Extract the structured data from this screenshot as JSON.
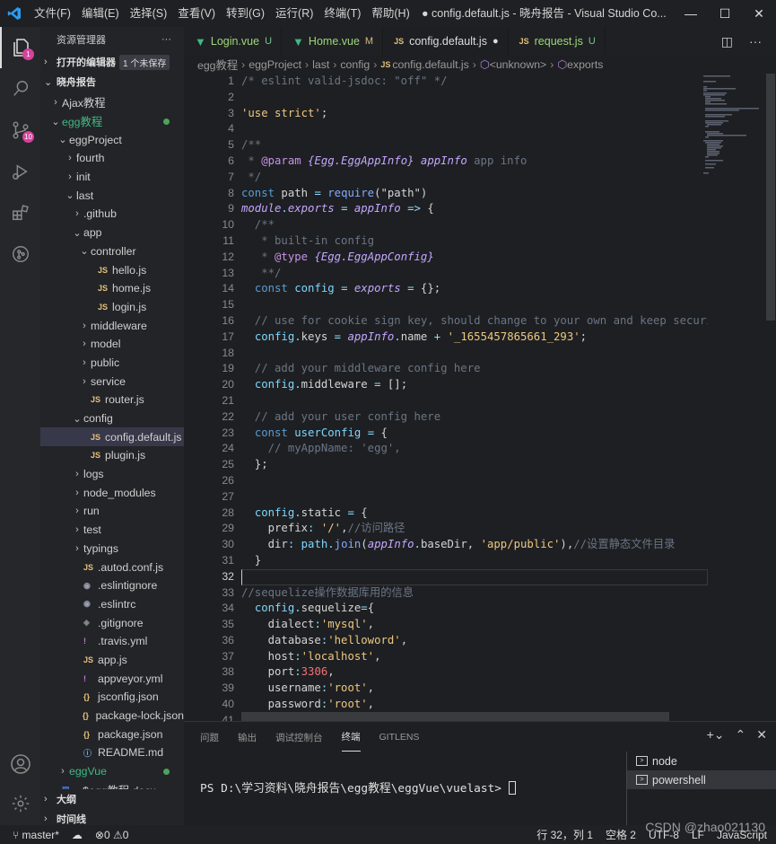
{
  "window": {
    "menu": [
      "文件(F)",
      "编辑(E)",
      "选择(S)",
      "查看(V)",
      "转到(G)",
      "运行(R)",
      "终端(T)",
      "帮助(H)"
    ],
    "title": "● config.default.js - 晓舟报告 - Visual Studio Co..."
  },
  "activity": {
    "explorer_badge": "1",
    "scm_badge": "10"
  },
  "sidebar": {
    "header": "资源管理器",
    "open_editors": "打开的编辑器",
    "unsaved": "1 个未保存",
    "workspace": "晓舟报告",
    "outline": "大纲",
    "timeline": "时间线",
    "items": [
      {
        "label": "Ajax教程",
        "depth": 1,
        "chev": "›",
        "icon": ""
      },
      {
        "label": "egg教程",
        "depth": 1,
        "chev": "⌄",
        "icon": "",
        "color": "#41b883",
        "dot": true
      },
      {
        "label": "eggProject",
        "depth": 2,
        "chev": "⌄",
        "icon": ""
      },
      {
        "label": "fourth",
        "depth": 3,
        "chev": "›",
        "icon": ""
      },
      {
        "label": "init",
        "depth": 3,
        "chev": "›",
        "icon": ""
      },
      {
        "label": "last",
        "depth": 3,
        "chev": "⌄",
        "icon": ""
      },
      {
        "label": ".github",
        "depth": 4,
        "chev": "›",
        "icon": ""
      },
      {
        "label": "app",
        "depth": 4,
        "chev": "⌄",
        "icon": ""
      },
      {
        "label": "controller",
        "depth": 5,
        "chev": "⌄",
        "icon": ""
      },
      {
        "label": "hello.js",
        "depth": 6,
        "chev": "",
        "icon": "JS"
      },
      {
        "label": "home.js",
        "depth": 6,
        "chev": "",
        "icon": "JS"
      },
      {
        "label": "login.js",
        "depth": 6,
        "chev": "",
        "icon": "JS"
      },
      {
        "label": "middleware",
        "depth": 5,
        "chev": "›",
        "icon": ""
      },
      {
        "label": "model",
        "depth": 5,
        "chev": "›",
        "icon": ""
      },
      {
        "label": "public",
        "depth": 5,
        "chev": "›",
        "icon": ""
      },
      {
        "label": "service",
        "depth": 5,
        "chev": "›",
        "icon": ""
      },
      {
        "label": "router.js",
        "depth": 5,
        "chev": "",
        "icon": "JS"
      },
      {
        "label": "config",
        "depth": 4,
        "chev": "⌄",
        "icon": ""
      },
      {
        "label": "config.default.js",
        "depth": 5,
        "chev": "",
        "icon": "JS",
        "selected": true
      },
      {
        "label": "plugin.js",
        "depth": 5,
        "chev": "",
        "icon": "JS"
      },
      {
        "label": "logs",
        "depth": 4,
        "chev": "›",
        "icon": ""
      },
      {
        "label": "node_modules",
        "depth": 4,
        "chev": "›",
        "icon": ""
      },
      {
        "label": "run",
        "depth": 4,
        "chev": "›",
        "icon": ""
      },
      {
        "label": "test",
        "depth": 4,
        "chev": "›",
        "icon": ""
      },
      {
        "label": "typings",
        "depth": 4,
        "chev": "›",
        "icon": ""
      },
      {
        "label": ".autod.conf.js",
        "depth": 4,
        "chev": "",
        "icon": "JS"
      },
      {
        "label": ".eslintignore",
        "depth": 4,
        "chev": "",
        "icon": "◉"
      },
      {
        "label": ".eslintrc",
        "depth": 4,
        "chev": "",
        "icon": "◉"
      },
      {
        "label": ".gitignore",
        "depth": 4,
        "chev": "",
        "icon": "◈"
      },
      {
        "label": ".travis.yml",
        "depth": 4,
        "chev": "",
        "icon": "!"
      },
      {
        "label": "app.js",
        "depth": 4,
        "chev": "",
        "icon": "JS"
      },
      {
        "label": "appveyor.yml",
        "depth": 4,
        "chev": "",
        "icon": "!"
      },
      {
        "label": "jsconfig.json",
        "depth": 4,
        "chev": "",
        "icon": "{}"
      },
      {
        "label": "package-lock.json",
        "depth": 4,
        "chev": "",
        "icon": "{}"
      },
      {
        "label": "package.json",
        "depth": 4,
        "chev": "",
        "icon": "{}"
      },
      {
        "label": "README.md",
        "depth": 4,
        "chev": "",
        "icon": "ⓘ"
      },
      {
        "label": "eggVue",
        "depth": 2,
        "chev": "›",
        "icon": "",
        "color": "#41b883",
        "dot": true
      },
      {
        "label": "~$egg教程.docx",
        "depth": 1,
        "chev": "",
        "icon": "▤"
      }
    ]
  },
  "tabs": [
    {
      "label": "Login.vue",
      "status": "U",
      "type": "vue",
      "active": false
    },
    {
      "label": "Home.vue",
      "status": "M",
      "type": "vue",
      "active": false
    },
    {
      "label": "config.default.js",
      "status": "●",
      "type": "js",
      "active": true
    },
    {
      "label": "request.js",
      "status": "U",
      "type": "js",
      "active": false
    }
  ],
  "breadcrumbs": [
    "egg教程",
    "eggProject",
    "last",
    "config",
    "config.default.js",
    "<unknown>",
    "exports"
  ],
  "editor": {
    "current_line": 32,
    "lines": [
      [
        [
          "c",
          "/* eslint valid-jsdoc: \"off\" */"
        ]
      ],
      [],
      [
        [
          "s",
          "'use strict'"
        ],
        [
          "t",
          ";"
        ]
      ],
      [],
      [
        [
          "c",
          "/**"
        ]
      ],
      [
        [
          "c",
          " * "
        ],
        [
          "tg",
          "@param"
        ],
        [
          "c",
          " "
        ],
        [
          "i",
          "{Egg.EggAppInfo}"
        ],
        [
          "c",
          " "
        ],
        [
          "i",
          "appInfo"
        ],
        [
          "c",
          " app info"
        ]
      ],
      [
        [
          "c",
          " */"
        ]
      ],
      [
        [
          "k",
          "const"
        ],
        [
          "t",
          " path "
        ],
        [
          "v",
          "="
        ],
        [
          "t",
          " "
        ],
        [
          "f",
          "require"
        ],
        [
          "t",
          "(\"path\")"
        ]
      ],
      [
        [
          "i",
          "module"
        ],
        [
          "v",
          "."
        ],
        [
          "i",
          "exports"
        ],
        [
          "t",
          " "
        ],
        [
          "v",
          "="
        ],
        [
          "t",
          " "
        ],
        [
          "i",
          "appInfo"
        ],
        [
          "t",
          " "
        ],
        [
          "v",
          "=>"
        ],
        [
          "t",
          " {"
        ]
      ],
      [
        [
          "c",
          "  /**"
        ]
      ],
      [
        [
          "c",
          "   * built-in config"
        ]
      ],
      [
        [
          "c",
          "   * "
        ],
        [
          "tg",
          "@type"
        ],
        [
          "c",
          " "
        ],
        [
          "i",
          "{Egg.EggAppConfig}"
        ]
      ],
      [
        [
          "c",
          "   **/"
        ]
      ],
      [
        [
          "t",
          "  "
        ],
        [
          "k",
          "const"
        ],
        [
          "t",
          " "
        ],
        [
          "pr",
          "config"
        ],
        [
          "t",
          " "
        ],
        [
          "v",
          "="
        ],
        [
          "t",
          " "
        ],
        [
          "i",
          "exports"
        ],
        [
          "t",
          " "
        ],
        [
          "v",
          "="
        ],
        [
          "t",
          " {};"
        ]
      ],
      [],
      [
        [
          "c",
          "  // use for cookie sign key, should change to your own and keep security"
        ]
      ],
      [
        [
          "t",
          "  "
        ],
        [
          "pr",
          "config"
        ],
        [
          "v",
          "."
        ],
        [
          "t",
          "keys "
        ],
        [
          "v",
          "="
        ],
        [
          "t",
          " "
        ],
        [
          "i",
          "appInfo"
        ],
        [
          "v",
          "."
        ],
        [
          "t",
          "name "
        ],
        [
          "v",
          "+"
        ],
        [
          "t",
          " "
        ],
        [
          "s",
          "'_1655457865661_293'"
        ],
        [
          "t",
          ";"
        ]
      ],
      [],
      [
        [
          "c",
          "  // add your middleware config here"
        ]
      ],
      [
        [
          "t",
          "  "
        ],
        [
          "pr",
          "config"
        ],
        [
          "v",
          "."
        ],
        [
          "t",
          "middleware "
        ],
        [
          "v",
          "="
        ],
        [
          "t",
          " [];"
        ]
      ],
      [],
      [
        [
          "c",
          "  // add your user config here"
        ]
      ],
      [
        [
          "t",
          "  "
        ],
        [
          "k",
          "const"
        ],
        [
          "t",
          " "
        ],
        [
          "pr",
          "userConfig"
        ],
        [
          "t",
          " "
        ],
        [
          "v",
          "="
        ],
        [
          "t",
          " {"
        ]
      ],
      [
        [
          "c",
          "    // myAppName: 'egg',"
        ]
      ],
      [
        [
          "t",
          "  };"
        ]
      ],
      [],
      [],
      [
        [
          "t",
          "  "
        ],
        [
          "pr",
          "config"
        ],
        [
          "v",
          "."
        ],
        [
          "t",
          "static "
        ],
        [
          "v",
          "="
        ],
        [
          "t",
          " {"
        ]
      ],
      [
        [
          "t",
          "    prefix"
        ],
        [
          "v",
          ":"
        ],
        [
          "t",
          " "
        ],
        [
          "s",
          "'/'"
        ],
        [
          "t",
          ","
        ],
        [
          "c",
          "//访问路径"
        ]
      ],
      [
        [
          "t",
          "    dir"
        ],
        [
          "v",
          ":"
        ],
        [
          "t",
          " "
        ],
        [
          "pr",
          "path"
        ],
        [
          "v",
          "."
        ],
        [
          "f",
          "join"
        ],
        [
          "t",
          "("
        ],
        [
          "i",
          "appInfo"
        ],
        [
          "v",
          "."
        ],
        [
          "t",
          "baseDir, "
        ],
        [
          "s",
          "'app/public'"
        ],
        [
          "t",
          "),"
        ],
        [
          "c",
          "//设置静态文件目录"
        ]
      ],
      [
        [
          "t",
          "  }"
        ]
      ],
      [],
      [
        [
          "c",
          "//sequelize操作数据库用的信息"
        ]
      ],
      [
        [
          "t",
          "  "
        ],
        [
          "pr",
          "config"
        ],
        [
          "v",
          "."
        ],
        [
          "t",
          "sequelize"
        ],
        [
          "v",
          "="
        ],
        [
          "t",
          "{"
        ]
      ],
      [
        [
          "t",
          "    dialect"
        ],
        [
          "v",
          ":"
        ],
        [
          "s",
          "'mysql'"
        ],
        [
          "t",
          ","
        ]
      ],
      [
        [
          "t",
          "    database"
        ],
        [
          "v",
          ":"
        ],
        [
          "s",
          "'helloword'"
        ],
        [
          "t",
          ","
        ]
      ],
      [
        [
          "t",
          "    host"
        ],
        [
          "v",
          ":"
        ],
        [
          "s",
          "'localhost'"
        ],
        [
          "t",
          ","
        ]
      ],
      [
        [
          "t",
          "    port"
        ],
        [
          "v",
          ":"
        ],
        [
          "p",
          "3306"
        ],
        [
          "t",
          ","
        ]
      ],
      [
        [
          "t",
          "    username"
        ],
        [
          "v",
          ":"
        ],
        [
          "s",
          "'root'"
        ],
        [
          "t",
          ","
        ]
      ],
      [
        [
          "t",
          "    password"
        ],
        [
          "v",
          ":"
        ],
        [
          "s",
          "'root'"
        ],
        [
          "t",
          ","
        ]
      ],
      [
        [
          "t",
          "  },"
        ]
      ]
    ]
  },
  "panel": {
    "tabs": [
      "问题",
      "输出",
      "调试控制台",
      "终端",
      "GITLENS"
    ],
    "active_tab": "终端",
    "terminal_prompt": "PS D:\\学习资料\\晓舟报告\\egg教程\\eggVue\\vuelast> ",
    "shells": [
      "node",
      "powershell"
    ],
    "active_shell": "powershell"
  },
  "statusbar": {
    "branch": "master*",
    "errors": "0",
    "warnings": "0",
    "position": "行 32，列 1",
    "spaces": "空格 2",
    "encoding": "UTF-8",
    "eol": "LF",
    "language": "JavaScript",
    "watermark": "CSDN @zhao021130"
  },
  "colors": {
    "accent": "#0078d4",
    "vue": "#41b883",
    "js": "#e5c07b",
    "badge": "#d6429c"
  }
}
